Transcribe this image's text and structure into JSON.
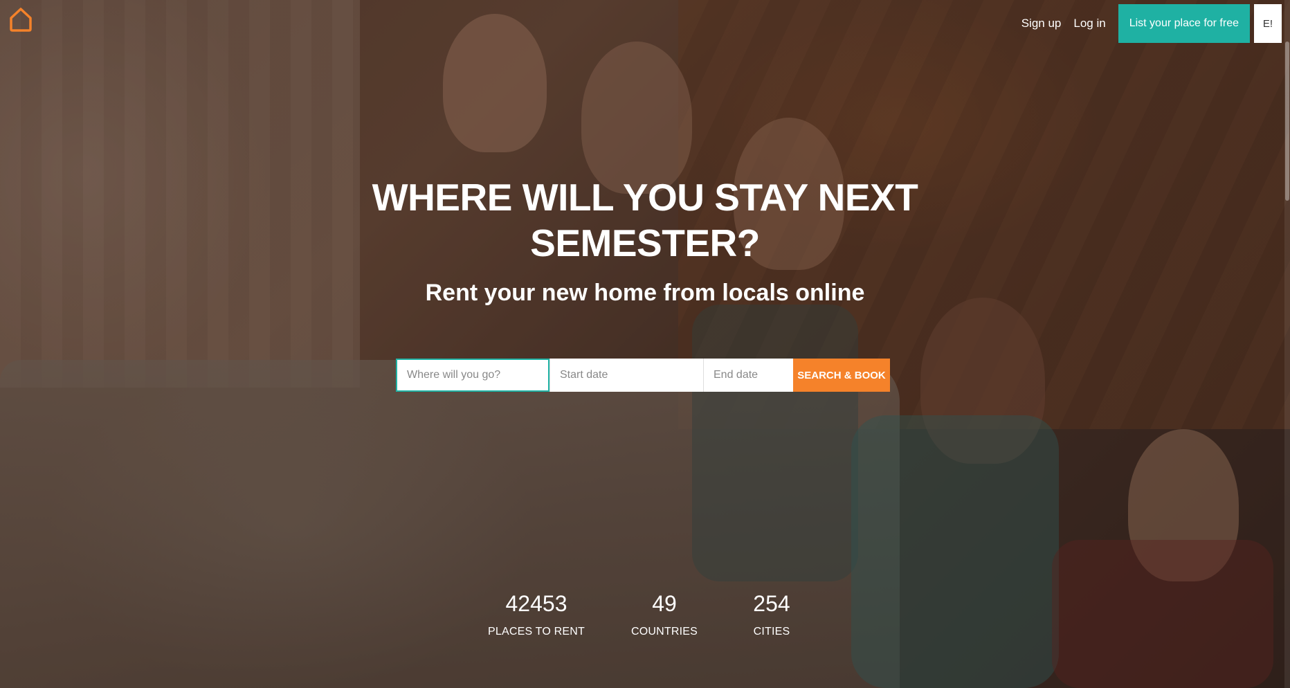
{
  "nav": {
    "logo_icon": "house-outline-icon",
    "signup": "Sign up",
    "login": "Log in",
    "list_place": "List your place for free",
    "language": "E!"
  },
  "hero": {
    "headline_line1": "WHERE WILL YOU STAY NEXT",
    "headline_line2": "SEMESTER?",
    "subheadline": "Rent your new home from locals online"
  },
  "search": {
    "where_placeholder": "Where will you go?",
    "start_placeholder": "Start date",
    "end_placeholder": "End date",
    "button": "SEARCH & BOOK"
  },
  "stats": [
    {
      "value": "42453",
      "label": "PLACES TO RENT"
    },
    {
      "value": "49",
      "label": "COUNTRIES"
    },
    {
      "value": "254",
      "label": "CITIES"
    }
  ],
  "colors": {
    "accent_teal": "#1fb1a3",
    "accent_orange": "#f5822a",
    "logo_orange": "#f5822a"
  }
}
